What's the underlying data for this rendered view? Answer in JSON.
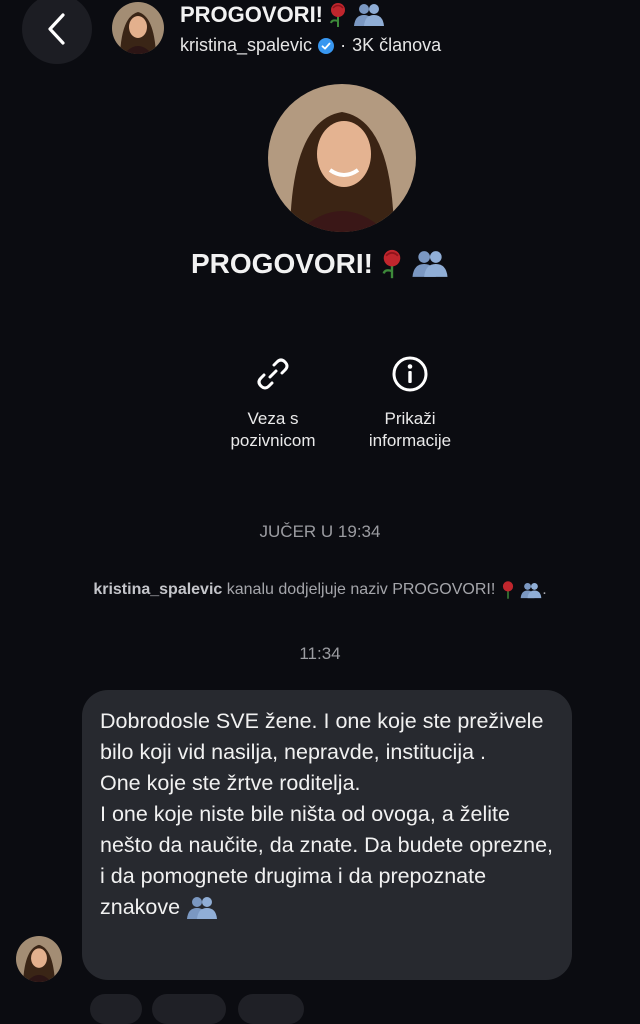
{
  "header": {
    "back_icon": "chevron-left-icon",
    "title": "PROGOVORI!",
    "username": "kristina_spalevic",
    "separator": "·",
    "members": "3K članova"
  },
  "profile": {
    "title": "PROGOVORI!"
  },
  "actions": [
    {
      "line1": "Veza s",
      "line2": "pozivnicom",
      "icon": "link-icon"
    },
    {
      "line1": "Prikaži",
      "line2": "informacije",
      "icon": "info-icon"
    }
  ],
  "timeline": {
    "date_divider": "JUČER U 19:34",
    "system_user": "kristina_spalevic",
    "system_text": " kanalu dodjeljuje naziv PROGOVORI!",
    "system_end": ".",
    "message_time": "11:34"
  },
  "message": {
    "p1": "Dobrodosle SVE žene. I one koje ste preživele bilo koji vid nasilja, nepravde, institucija .",
    "p2": "One koje ste žrtve roditelja.",
    "p3": "I one koje niste bile ništa od ovoga, a želite nešto da naučite, da znate. Da budete oprezne, i da pomognete drugima i da prepoznate znakove"
  },
  "colors": {
    "background": "#0b0c11",
    "bubble": "#27292f",
    "verified": "#3897f0",
    "rose": "#c0262d"
  }
}
